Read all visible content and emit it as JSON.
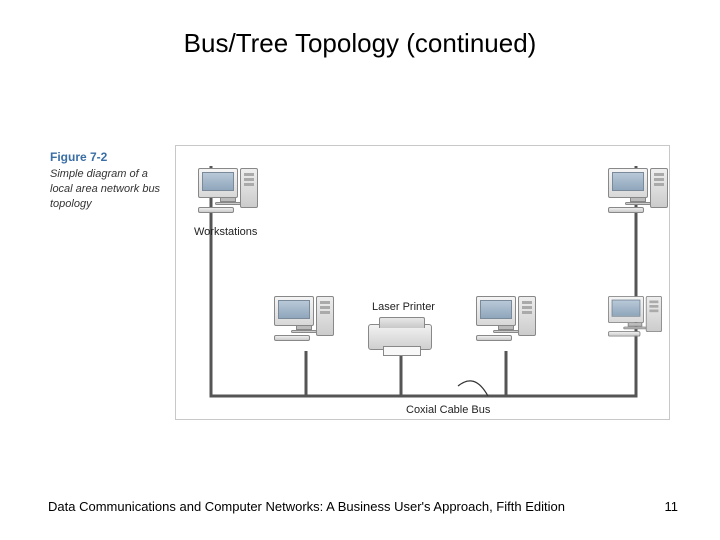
{
  "title": "Bus/Tree Topology (continued)",
  "figure": {
    "number": "Figure 7-2",
    "caption": "Simple diagram of a local area network bus topology"
  },
  "labels": {
    "workstations": "Workstations",
    "laser_printer": "Laser Printer",
    "coaxial_cable_bus": "Coxial Cable Bus"
  },
  "footer": "Data Communications and Computer Networks: A Business User's Approach, Fifth Edition",
  "page_number": "11"
}
